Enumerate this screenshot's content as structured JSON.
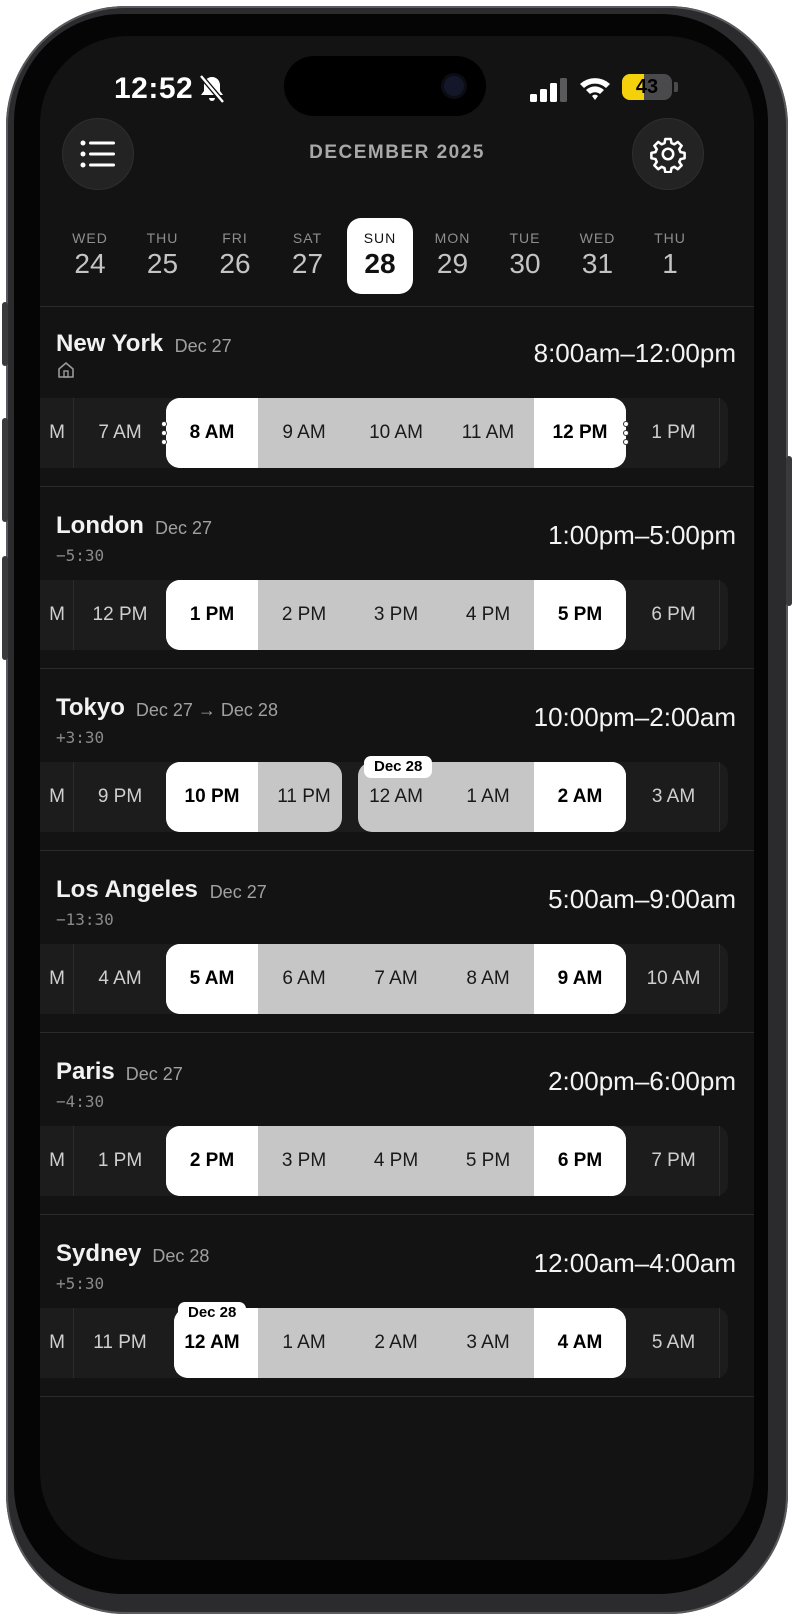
{
  "status": {
    "time": "12:52",
    "battery": "43",
    "battery_level": 0.43
  },
  "header": {
    "month": "DECEMBER 2025",
    "menu_icon": "list-icon",
    "settings_icon": "gear-icon"
  },
  "days": [
    {
      "dow": "WED",
      "num": "24"
    },
    {
      "dow": "THU",
      "num": "25"
    },
    {
      "dow": "FRI",
      "num": "26"
    },
    {
      "dow": "SAT",
      "num": "27"
    },
    {
      "dow": "SUN",
      "num": "28",
      "active": true
    },
    {
      "dow": "MON",
      "num": "29"
    },
    {
      "dow": "TUE",
      "num": "30"
    },
    {
      "dow": "WED",
      "num": "31"
    },
    {
      "dow": "THU",
      "num": "1"
    }
  ],
  "cities": [
    {
      "name": "New York",
      "date": "Dec 27",
      "offset": "",
      "home": true,
      "range": "8:00am–12:00pm",
      "edge": "M",
      "before": "7 AM",
      "selected": [
        "8 AM",
        "9 AM",
        "10 AM",
        "11 AM",
        "12 PM"
      ],
      "after": "1 PM",
      "handles": true
    },
    {
      "name": "London",
      "date": "Dec 27",
      "offset": "−5:30",
      "range": "1:00pm–5:00pm",
      "edge": "M",
      "before": "12 PM",
      "selected": [
        "1 PM",
        "2 PM",
        "3 PM",
        "4 PM",
        "5 PM"
      ],
      "after": "6 PM"
    },
    {
      "name": "Tokyo",
      "date": "Dec 27 → Dec 28",
      "offset": "+3:30",
      "range": "10:00pm–2:00am",
      "edge": "M",
      "before": "9 PM",
      "selected": [
        "10 PM",
        "11 PM",
        "12 AM",
        "1 AM",
        "2 AM"
      ],
      "after": "3 AM",
      "split_after": 2,
      "badge": "Dec 28"
    },
    {
      "name": "Los Angeles",
      "date": "Dec 27",
      "offset": "−13:30",
      "range": "5:00am–9:00am",
      "edge": "M",
      "before": "4 AM",
      "selected": [
        "5 AM",
        "6 AM",
        "7 AM",
        "8 AM",
        "9 AM"
      ],
      "after": "10 AM"
    },
    {
      "name": "Paris",
      "date": "Dec 27",
      "offset": "−4:30",
      "range": "2:00pm–6:00pm",
      "edge": "M",
      "before": "1 PM",
      "selected": [
        "2 PM",
        "3 PM",
        "4 PM",
        "5 PM",
        "6 PM"
      ],
      "after": "7 PM"
    },
    {
      "name": "Sydney",
      "date": "Dec 28",
      "offset": "+5:30",
      "range": "12:00am–4:00am",
      "edge": "M",
      "before": "11 PM",
      "selected": [
        "12 AM",
        "1 AM",
        "2 AM",
        "3 AM",
        "4 AM"
      ],
      "after": "5 AM",
      "badge_first": "Dec 28"
    }
  ]
}
